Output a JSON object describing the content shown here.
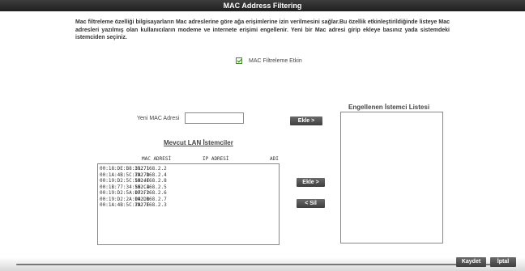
{
  "header": {
    "title": "MAC Address Filtering"
  },
  "description": "Mac filtreleme özelliği bilgisayarların Mac adreslerine göre ağa erişimlerine izin verilmesini sağlar.Bu özellik etkinleştirildiğinde listeye Mac adresleri yazılmış olan kullanıcıların modeme ve internete erişimi engellenir. Yeni bir Mac adresi girip ekleye basınız yada sistemdeki istemciden seçiniz.",
  "mac_filter": {
    "label": "MAC Filtreleme Etkin",
    "checked": true
  },
  "new_mac": {
    "label": "Yeni MAC Adresi",
    "value": "",
    "add_button": "Ekle >"
  },
  "lan": {
    "title": "Mevcut LAN İstemciler",
    "columns": {
      "mac": "MAC ADRESİ",
      "ip": "IP ADRESİ",
      "name": "ADI"
    },
    "clients": [
      {
        "mac": "00:18:DE:B8:31:71",
        "ip": "192.168.2.2"
      },
      {
        "mac": "00:1A:4B:5C:7A:7D",
        "ip": "192.168.2.4"
      },
      {
        "mac": "00:19:D2:5C:50:4F",
        "ip": "192.168.2.8"
      },
      {
        "mac": "00:1B:77:34:56:C4",
        "ip": "192.168.2.5"
      },
      {
        "mac": "00:19:D2:5A:07:F2",
        "ip": "192.168.2.6"
      },
      {
        "mac": "00:19:D2:2A:04:DB",
        "ip": "192.168.2.7"
      },
      {
        "mac": "00:1A:4B:5C:7A:7F",
        "ip": "192.168.2.3"
      }
    ],
    "add_button": "Ekle >",
    "delete_button": "< Sil"
  },
  "blocked": {
    "title": "Engellenen İstemci Listesi",
    "items": []
  },
  "footer": {
    "save_button": "Kaydet",
    "cancel_button": "İptal"
  },
  "colors": {
    "titlebar": "#2b2b2b",
    "button": "#4a4a4a",
    "checkbox": "#2d7a18"
  }
}
